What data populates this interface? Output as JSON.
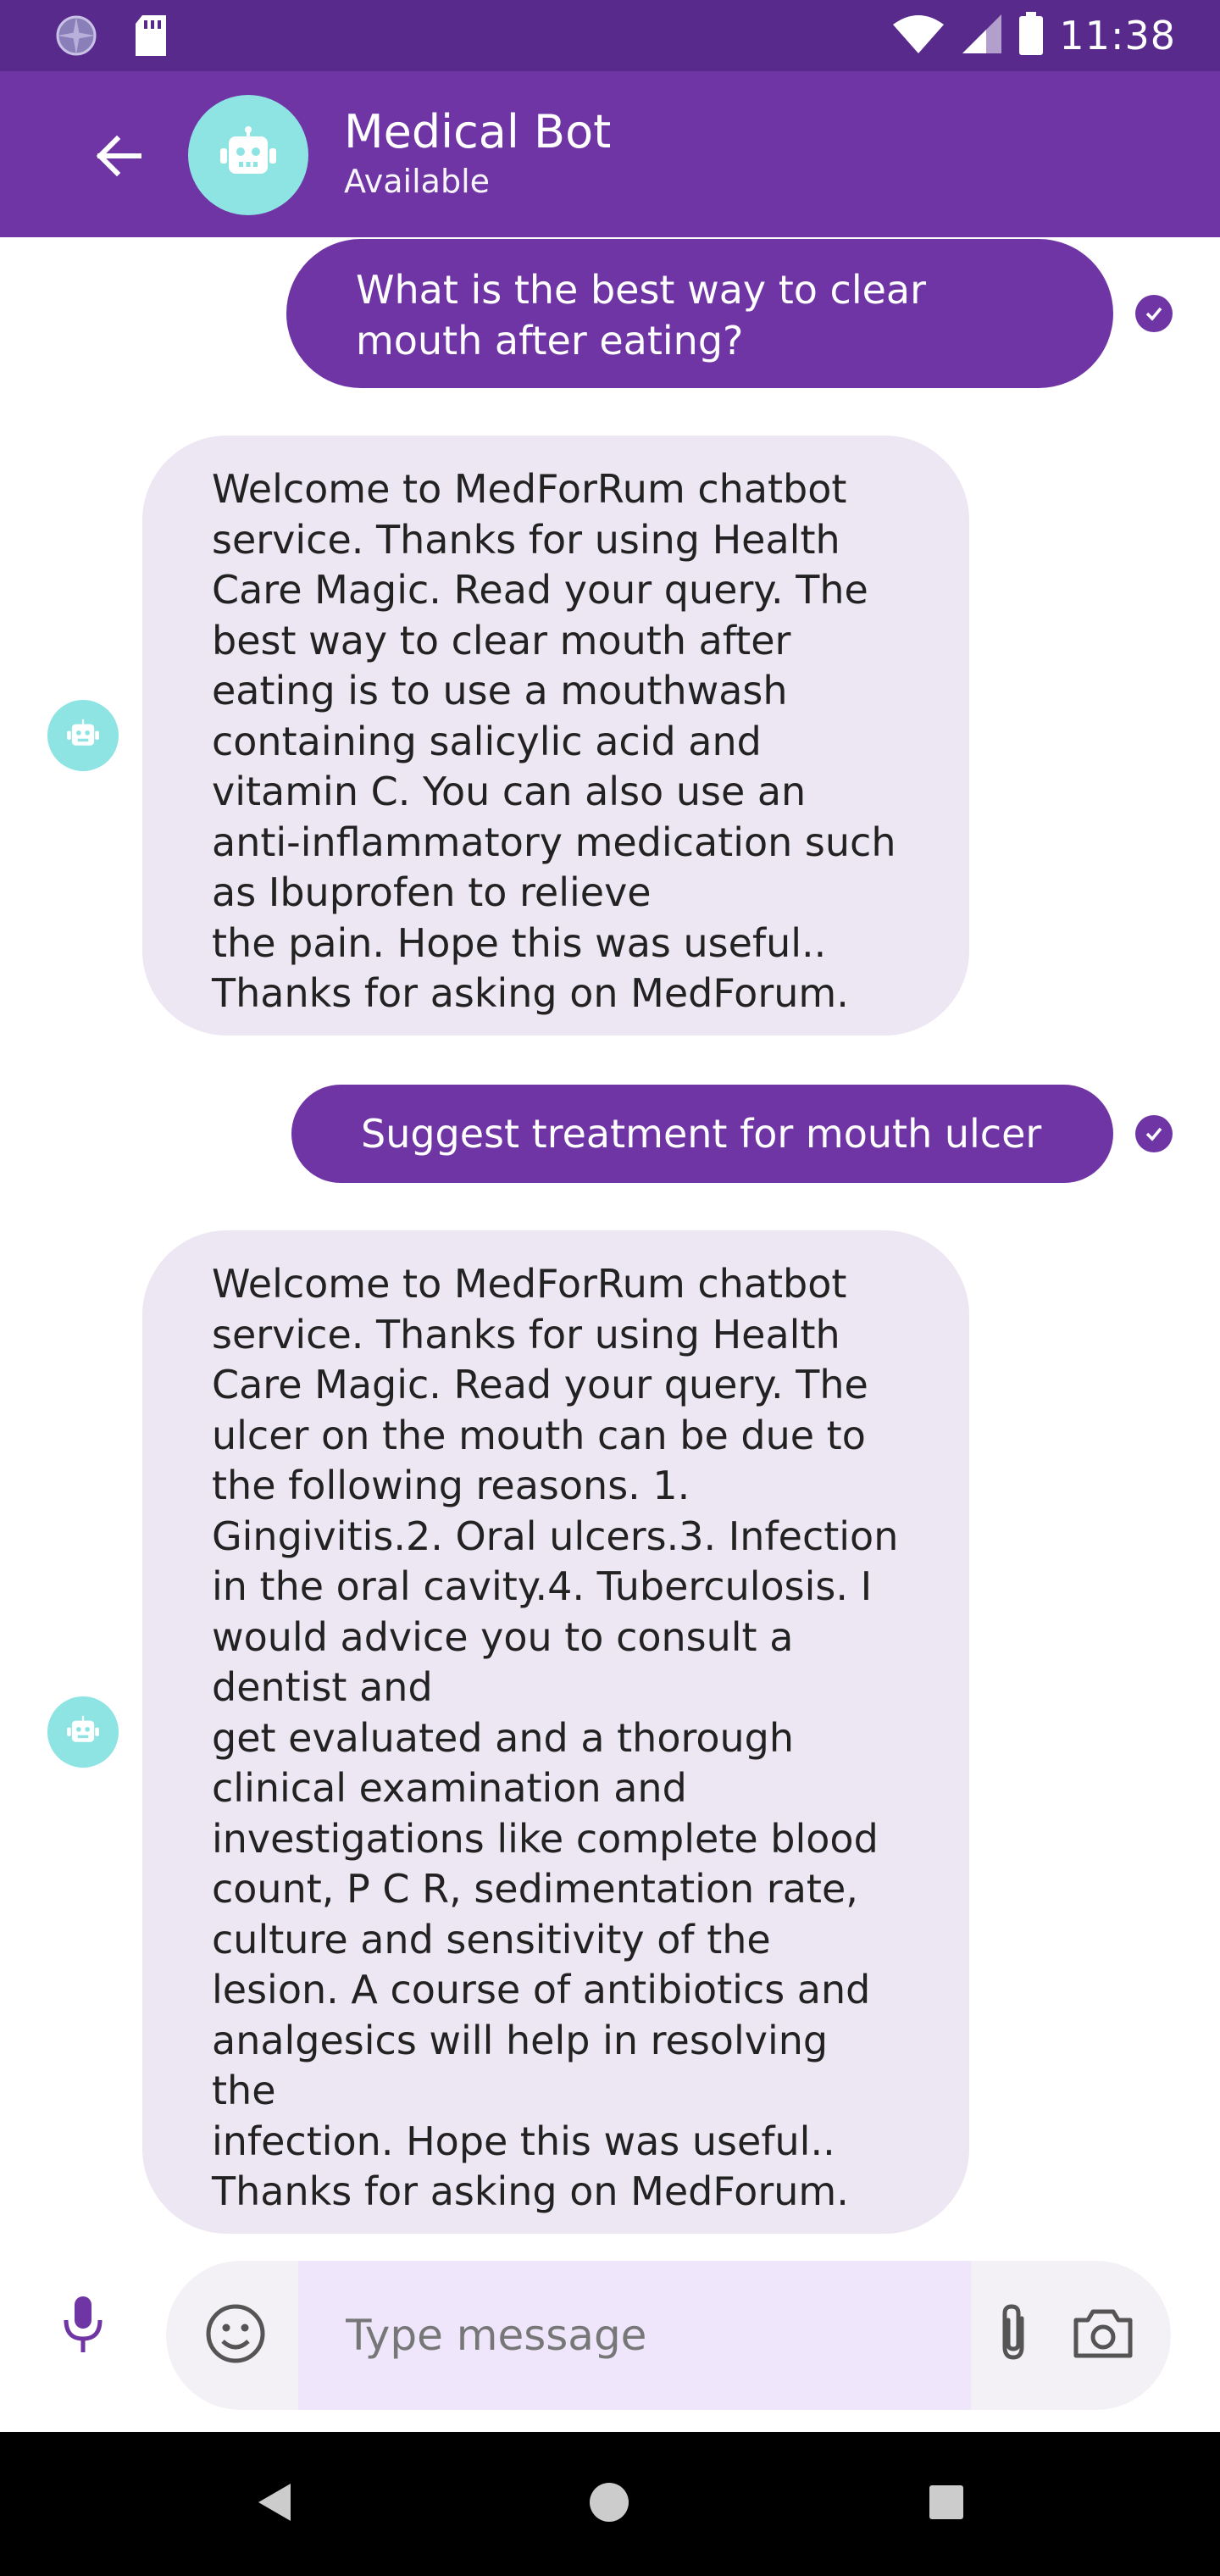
{
  "status_bar": {
    "time": "11:38",
    "icons": [
      "pinwheel-icon",
      "sd-card-icon",
      "wifi-icon",
      "cell-signal-icon",
      "battery-icon"
    ]
  },
  "header": {
    "title": "Medical Bot",
    "subtitle": "Available",
    "back_icon": "back-arrow-icon",
    "avatar_icon": "robot-icon"
  },
  "messages": [
    {
      "sender": "user",
      "text": "What is the best way to clear mouth after eating?",
      "status_icon": "check-circle-icon"
    },
    {
      "sender": "bot",
      "text": "Welcome to MedForRum chatbot service. Thanks for using  Health Care  Magic. Read your query. The best way to clear mouth after eating is to use a mouthwash containing salicylic acid and vitamin  C. You can also use an anti-inflammatory medication such as  Ibuprofen to relieve\nthe pain. Hope this was useful.. Thanks for asking on MedForum."
    },
    {
      "sender": "user",
      "text": "Suggest treatment for mouth ulcer",
      "status_icon": "check-circle-icon"
    },
    {
      "sender": "bot",
      "text": "Welcome to MedForRum chatbot service. Thanks for using  Health Care  Magic. Read your query. The ulcer on the mouth can be due to the following reasons. 1. Gingivitis.2. Oral ulcers.3. Infection in the oral cavity.4. Tuberculosis. I would advice you to consult a dentist and\nget evaluated and a thorough clinical examination and investigations like complete blood count,  P C R, sedimentation rate, culture and sensitivity of the lesion. A course of antibiotics and analgesics will help in resolving the\ninfection. Hope this was useful.. Thanks for asking on MedForum."
    }
  ],
  "composer": {
    "placeholder": "Type message",
    "value": "",
    "icons": [
      "microphone-icon",
      "emoji-icon",
      "paperclip-icon",
      "camera-icon"
    ]
  },
  "nav_bar": {
    "icons": [
      "nav-back-icon",
      "nav-home-icon",
      "nav-recents-icon"
    ]
  },
  "colors": {
    "status_bar": "#572a8c",
    "header": "#6f35a5",
    "user_bubble": "#6f35a5",
    "bot_bubble": "#ece7f2",
    "avatar": "#8ee3e3",
    "input_field": "#efe6fb"
  }
}
